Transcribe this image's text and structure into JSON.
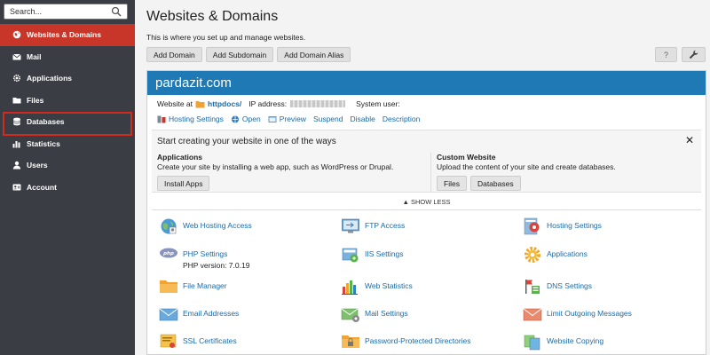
{
  "search": {
    "placeholder": "Search..."
  },
  "sidebar": {
    "items": [
      {
        "label": "Websites & Domains"
      },
      {
        "label": "Mail"
      },
      {
        "label": "Applications"
      },
      {
        "label": "Files"
      },
      {
        "label": "Databases"
      },
      {
        "label": "Statistics"
      },
      {
        "label": "Users"
      },
      {
        "label": "Account"
      }
    ]
  },
  "header": {
    "title": "Websites & Domains",
    "description": "This is where you set up and manage websites."
  },
  "toolbar": {
    "add_domain": "Add Domain",
    "add_subdomain": "Add Subdomain",
    "add_domain_alias": "Add Domain Alias",
    "help_label": "?"
  },
  "domain": {
    "name": "pardazit.com",
    "website_at_label": "Website at",
    "website_at_link": "httpdocs/",
    "ip_label": "IP address:",
    "system_user_label": "System user:",
    "actions": {
      "hosting_settings": "Hosting Settings",
      "open": "Open",
      "preview": "Preview",
      "suspend": "Suspend",
      "disable": "Disable",
      "description": "Description"
    }
  },
  "start": {
    "title": "Start creating your website in one of the ways",
    "close": "✕",
    "applications": {
      "title": "Applications",
      "desc": "Create your site by installing a web app, such as WordPress or Drupal.",
      "button": "Install Apps"
    },
    "custom": {
      "title": "Custom Website",
      "desc": "Upload the content of your site and create databases.",
      "files_button": "Files",
      "databases_button": "Databases"
    }
  },
  "show_less": "▲ SHOW LESS",
  "tools": {
    "web_hosting_access": "Web Hosting Access",
    "ftp_access": "FTP Access",
    "hosting_settings": "Hosting Settings",
    "php_settings": "PHP Settings",
    "php_version": "PHP version: 7.0.19",
    "iis_settings": "IIS Settings",
    "applications": "Applications",
    "file_manager": "File Manager",
    "web_statistics": "Web Statistics",
    "dns_settings": "DNS Settings",
    "email_addresses": "Email Addresses",
    "mail_settings": "Mail Settings",
    "limit_outgoing": "Limit Outgoing Messages",
    "ssl_certificates": "SSL Certificates",
    "password_protected": "Password-Protected Directories",
    "website_copying": "Website Copying"
  },
  "colors": {
    "sidebar_bg": "#3a3e44",
    "active_item": "#c8362a",
    "panel_header": "#1e79b5",
    "link": "#1a6aa8",
    "highlight_border": "#d42a1e"
  }
}
